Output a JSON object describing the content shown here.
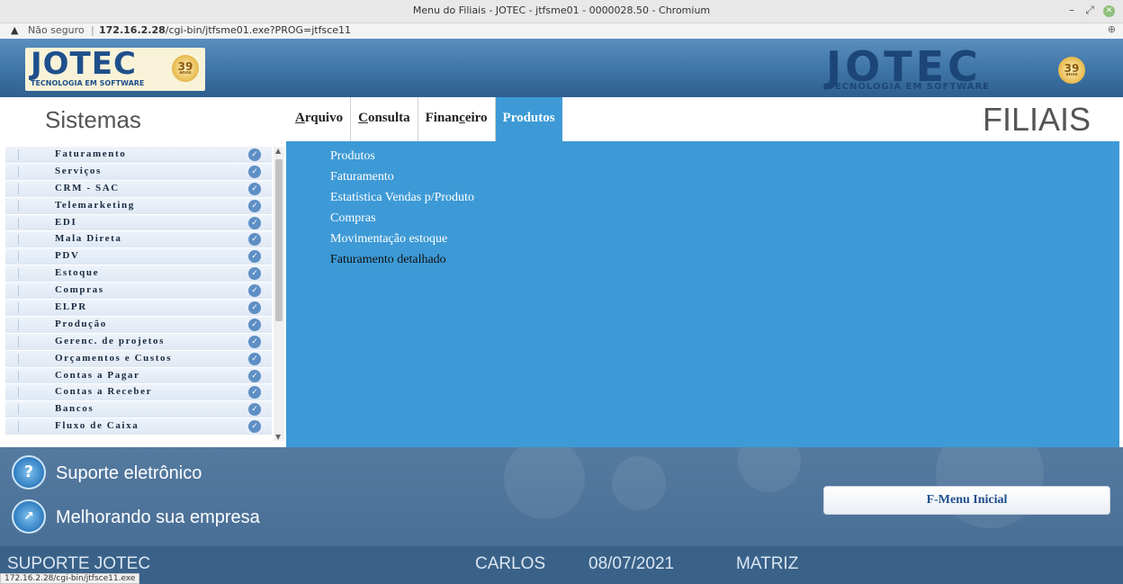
{
  "browser": {
    "window_title": "Menu do Filiais - JOTEC - jtfsme01 - 0000028.50 - Chromium",
    "not_secure_label": "Não seguro",
    "url_host": "172.16.2.28",
    "url_path": "/cgi-bin/jtfsme01.exe?PROG=jtfsce11",
    "status_url": "172.16.2.28/cgi-bin/jtfsce11.exe"
  },
  "banner": {
    "logo_text": "JOTEC",
    "logo_subtitle": "TECNOLOGIA EM SOFTWARE",
    "badge_number": "39",
    "badge_label": "anos"
  },
  "nav": {
    "sistemas_label": "Sistemas",
    "page_title": "FILIAIS",
    "menu": [
      {
        "pre": "",
        "accel": "A",
        "post": "rquivo"
      },
      {
        "pre": "",
        "accel": "C",
        "post": "onsulta"
      },
      {
        "pre": "Finan",
        "accel": "c",
        "post": "eiro"
      },
      {
        "pre": "Produtos",
        "accel": "",
        "post": ""
      }
    ],
    "active_menu": "Produtos"
  },
  "sidebar": {
    "items": [
      {
        "label": "Faturamento"
      },
      {
        "label": "Serviços"
      },
      {
        "label": "CRM - SAC"
      },
      {
        "label": "Telemarketing"
      },
      {
        "label": "EDI"
      },
      {
        "label": "Mala Direta"
      },
      {
        "label": "PDV"
      },
      {
        "label": "Estoque"
      },
      {
        "label": "Compras"
      },
      {
        "label": "ELPR"
      },
      {
        "label": "Produção"
      },
      {
        "label": "Gerenc. de projetos"
      },
      {
        "label": "Orçamentos e Custos"
      },
      {
        "label": "Contas a Pagar"
      },
      {
        "label": "Contas a Receber"
      },
      {
        "label": "Bancos"
      },
      {
        "label": "Fluxo de Caixa"
      }
    ]
  },
  "submenu": {
    "items": [
      {
        "label": "Produtos"
      },
      {
        "label": "Faturamento"
      },
      {
        "label": "Estatística Vendas p/Produto"
      },
      {
        "label": "Compras"
      },
      {
        "label": "Movimentação estoque"
      },
      {
        "label": "Faturamento detalhado"
      }
    ]
  },
  "footer": {
    "support_label": "Suporte eletrônico",
    "improve_label": "Melhorando sua empresa",
    "fmenu_button": "F-Menu Inicial"
  },
  "status": {
    "support": "SUPORTE JOTEC",
    "user": "CARLOS",
    "date": "08/07/2021",
    "branch": "MATRIZ"
  },
  "colors": {
    "content_bg": "#3d9ad6",
    "banner_bg": "#3e74a6",
    "status_bg": "#3a6289"
  }
}
